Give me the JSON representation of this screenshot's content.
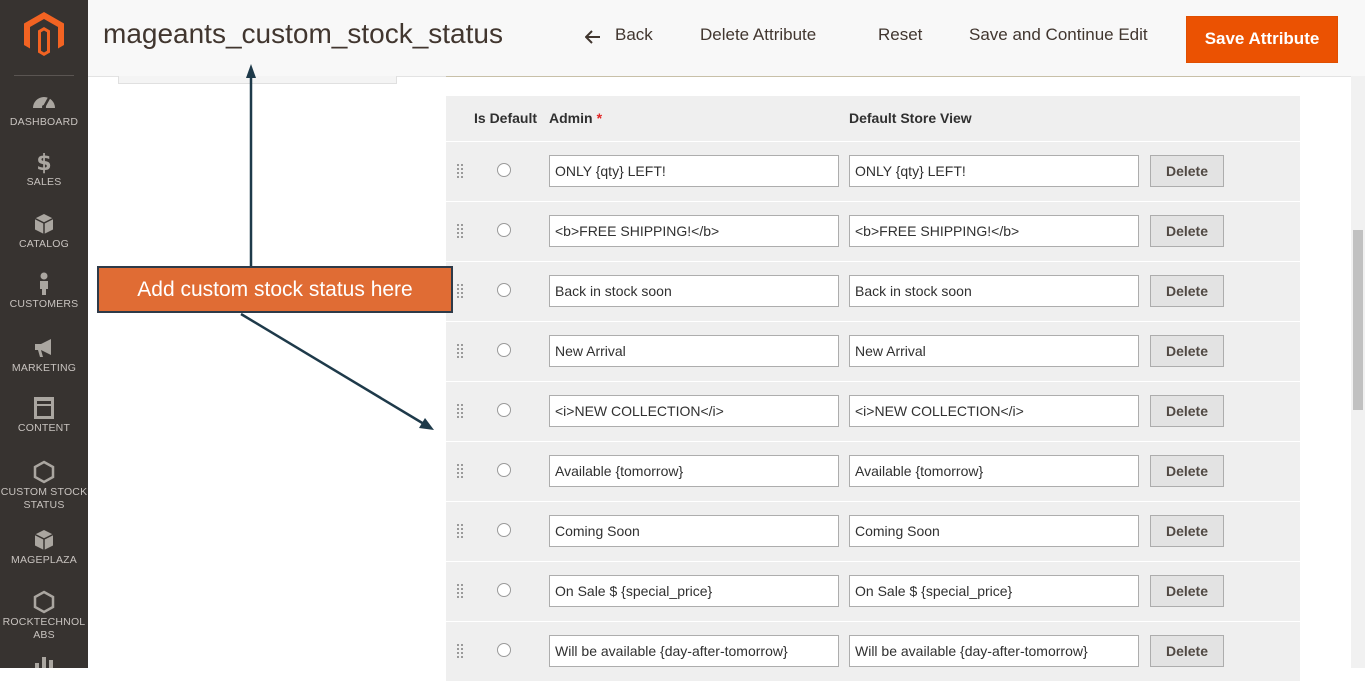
{
  "sidebar": {
    "items": [
      {
        "label": "DASHBOARD",
        "icon": "dashboard-icon"
      },
      {
        "label": "SALES",
        "icon": "dollar-icon"
      },
      {
        "label": "CATALOG",
        "icon": "cube-icon"
      },
      {
        "label": "CUSTOMERS",
        "icon": "person-icon"
      },
      {
        "label": "MARKETING",
        "icon": "megaphone-icon"
      },
      {
        "label": "CONTENT",
        "icon": "layout-icon"
      },
      {
        "label": "CUSTOM STOCK",
        "label2": "STATUS",
        "icon": "hexagon-icon"
      },
      {
        "label": "MAGEPLAZA",
        "icon": "cube-icon"
      },
      {
        "label": "ROCKTECHNOL",
        "label2": "ABS",
        "icon": "hexagon-icon"
      }
    ]
  },
  "header": {
    "title": "mageants_custom_stock_status",
    "back_label": "Back",
    "delete_label": "Delete Attribute",
    "reset_label": "Reset",
    "save_continue_label": "Save and Continue Edit",
    "save_label": "Save Attribute"
  },
  "table": {
    "headers": {
      "is_default": "Is Default",
      "admin": "Admin",
      "required": "*",
      "store": "Default Store View"
    },
    "delete_label": "Delete",
    "rows": [
      {
        "admin": "ONLY {qty} LEFT!",
        "store": "ONLY {qty} LEFT!"
      },
      {
        "admin": "<b>FREE SHIPPING!</b>",
        "store": "<b>FREE SHIPPING!</b>"
      },
      {
        "admin": "Back in stock soon",
        "store": "Back in stock soon"
      },
      {
        "admin": "New Arrival",
        "store": "New Arrival"
      },
      {
        "admin": "<i>NEW COLLECTION</i>",
        "store": "<i>NEW COLLECTION</i>"
      },
      {
        "admin": "Available {tomorrow}",
        "store": "Available {tomorrow}"
      },
      {
        "admin": "Coming Soon",
        "store": "Coming Soon"
      },
      {
        "admin": "On Sale $ {special_price}",
        "store": "On Sale $ {special_price}"
      },
      {
        "admin": "Will be available {day-after-tomorrow}",
        "store": "Will be available {day-after-tomorrow}"
      }
    ]
  },
  "annotation": {
    "text": "Add custom stock status here"
  },
  "colors": {
    "accent": "#eb5202",
    "sidebar": "#373330",
    "callout": "#e06c34",
    "arrow": "#1e3a4a"
  }
}
